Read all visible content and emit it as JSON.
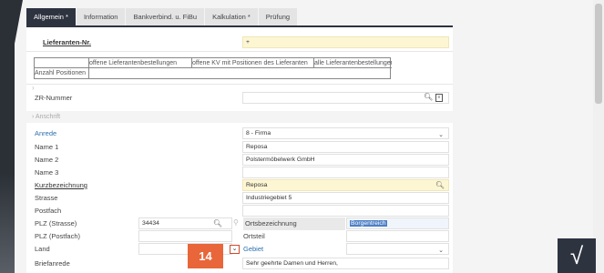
{
  "tabs": [
    {
      "label": "Allgemein *",
      "active": true
    },
    {
      "label": "Information",
      "active": false
    },
    {
      "label": "Bankverbind. u. FiBu",
      "active": false
    },
    {
      "label": "Kalkulation *",
      "active": false
    },
    {
      "label": "Prüfung",
      "active": false
    }
  ],
  "lieferanten": {
    "label": "Lieferanten-Nr.",
    "value": "+"
  },
  "mini_table": {
    "col1": "offene Lieferantenbestellungen",
    "col2": "offene KV mit Positionen des Lieferanten",
    "col3": "alle Lieferantenbestellungen",
    "row_label": "Anzahl Positionen"
  },
  "zr": {
    "label": "ZR-Nummer",
    "value": ""
  },
  "section_anschrift": "Anschrift",
  "fields": {
    "anrede": {
      "label": "Anrede",
      "value": "8 - Firma"
    },
    "name1": {
      "label": "Name 1",
      "value": "Reposa"
    },
    "name2": {
      "label": "Name 2",
      "value": "Polstermöbelwerk GmbH"
    },
    "name3": {
      "label": "Name 3",
      "value": ""
    },
    "kurzbezeichnung": {
      "label": "Kurzbezeichnung",
      "value": "Reposa"
    },
    "strasse": {
      "label": "Strasse",
      "value": "Industriegebiet 5"
    },
    "postfach": {
      "label": "Postfach",
      "value": ""
    },
    "plz_strasse": {
      "label": "PLZ (Strasse)",
      "value": "34434"
    },
    "ortsbezeichnung": {
      "label": "Ortsbezeichnung",
      "value": "Borgentreich"
    },
    "plz_postfach": {
      "label": "PLZ (Postfach)",
      "value": ""
    },
    "ortsteil": {
      "label": "Ortsteil",
      "value": ""
    },
    "land": {
      "label": "Land",
      "value": ""
    },
    "gebiet": {
      "label": "Gebiet",
      "value": ""
    },
    "briefanrede": {
      "label": "Briefanrede",
      "value": "Sehr geehrte Damen und Herren,"
    }
  },
  "step_marker": "14",
  "confirm_icon": "√",
  "icons": {
    "search": "search-icon",
    "card": "card-icon",
    "chevron": "chevron-down-icon",
    "location": "location-icon"
  }
}
